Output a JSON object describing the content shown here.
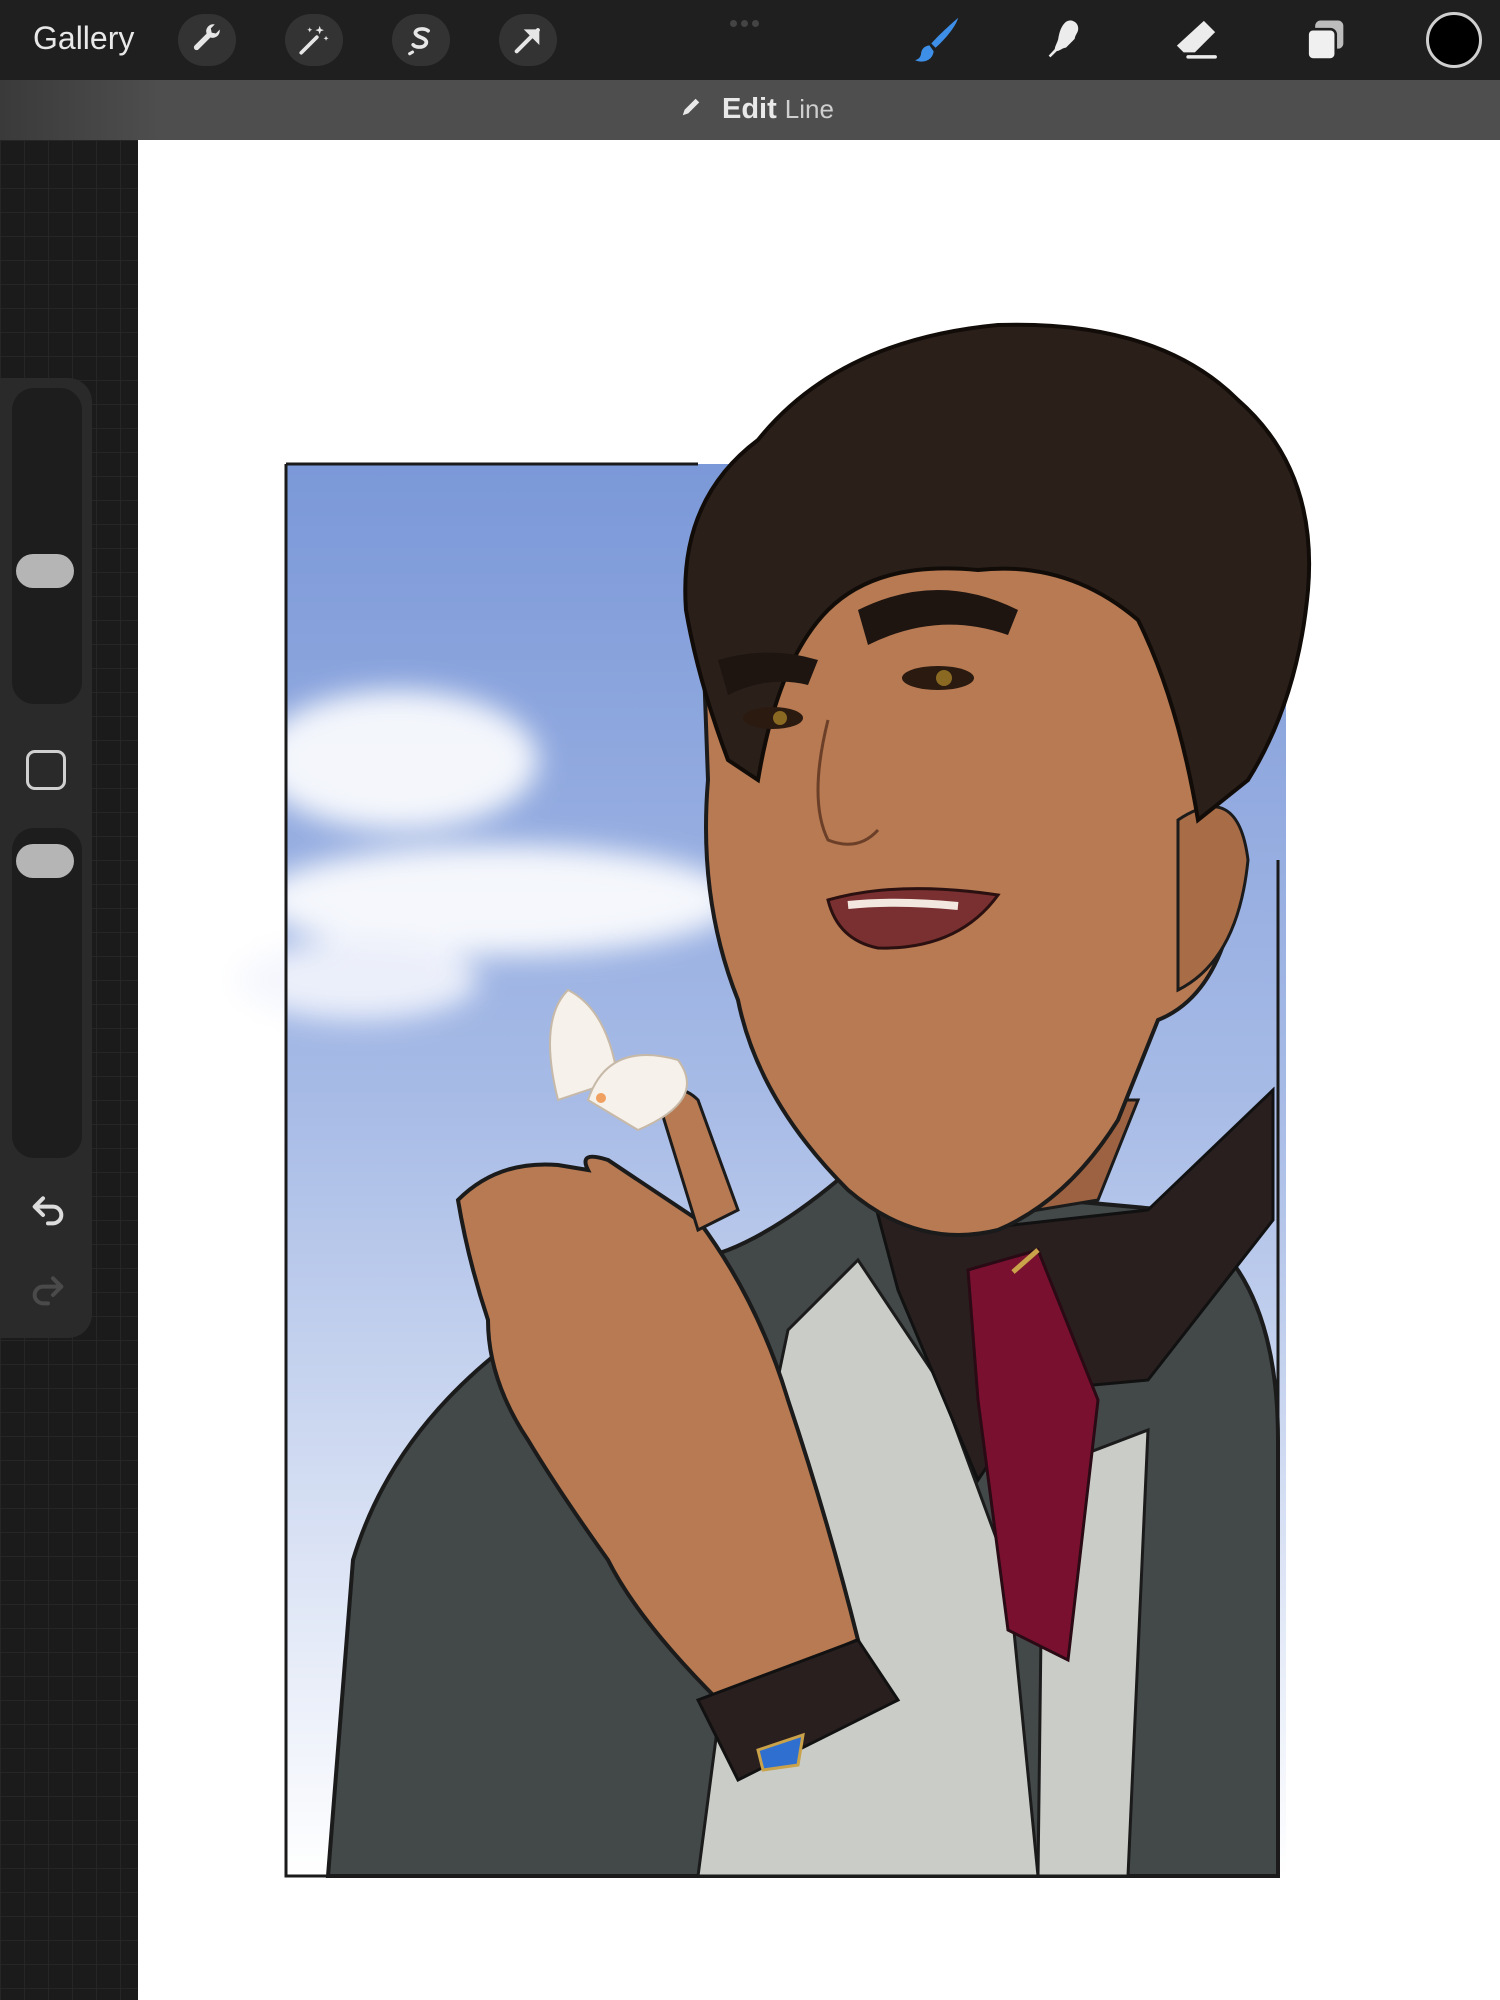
{
  "toolbar": {
    "gallery_label": "Gallery",
    "left_tools": [
      {
        "name": "actions",
        "icon": "wrench-icon"
      },
      {
        "name": "adjustments",
        "icon": "magic-wand-icon"
      },
      {
        "name": "selection",
        "icon": "selection-s-icon"
      },
      {
        "name": "transform",
        "icon": "arrow-cursor-icon"
      }
    ],
    "right_tools": [
      {
        "name": "brush",
        "icon": "brush-icon",
        "active": true
      },
      {
        "name": "smudge",
        "icon": "smudge-icon"
      },
      {
        "name": "eraser",
        "icon": "eraser-icon"
      },
      {
        "name": "layers",
        "icon": "layers-icon"
      }
    ],
    "current_color": "#000000",
    "active_color": "#3d8fe8"
  },
  "banner": {
    "edit_label": "Edit",
    "shape_label": "Line"
  },
  "sidebar": {
    "size_slider_level": 0.55,
    "opacity_slider_level": 0.95,
    "modify_button_icon": "square-icon",
    "undo_icon": "undo-arrow-icon",
    "redo_icon": "redo-arrow-icon"
  },
  "canvas": {
    "content": "illustration",
    "sky_color": "#7e9bd9",
    "hair_color": "#2b1f1a",
    "skin_color": "#b77a52",
    "tie_color": "#7a1030",
    "vest_color": "#434849",
    "shirt_color": "#c9ccc7"
  }
}
